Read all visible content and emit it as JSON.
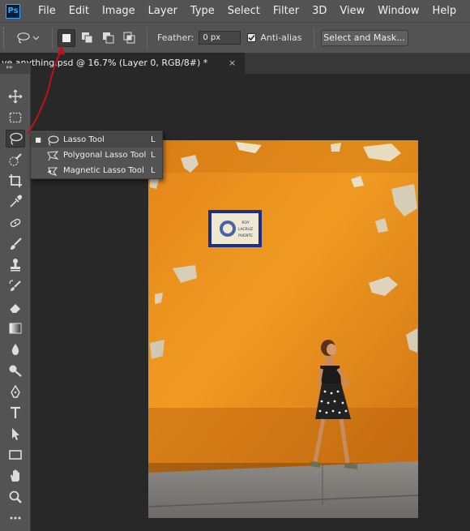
{
  "app": {
    "logo_text": "Ps"
  },
  "menu": [
    "File",
    "Edit",
    "Image",
    "Layer",
    "Type",
    "Select",
    "Filter",
    "3D",
    "View",
    "Window",
    "Help"
  ],
  "options": {
    "feather_label": "Feather:",
    "feather_value": "0 px",
    "antialias_label": "Anti-alias",
    "antialias_checked": true,
    "select_mask_label": "Select and Mask..."
  },
  "document": {
    "tab_title": "ve anything.psd @ 16.7% (Layer 0, RGB/8#) *",
    "close_glyph": "×"
  },
  "flyout": {
    "items": [
      {
        "label": "Lasso Tool",
        "shortcut": "L",
        "selected": true,
        "icon": "lasso-icon"
      },
      {
        "label": "Polygonal Lasso Tool",
        "shortcut": "L",
        "selected": false,
        "icon": "polygonal-lasso-icon"
      },
      {
        "label": "Magnetic Lasso Tool",
        "shortcut": "L",
        "selected": false,
        "icon": "magnetic-lasso-icon"
      }
    ]
  },
  "toolbar_icons": [
    "move-icon",
    "marquee-icon",
    "lasso-icon",
    "quick-selection-icon",
    "crop-icon",
    "eyedropper-icon",
    "healing-brush-icon",
    "brush-icon",
    "clone-stamp-icon",
    "history-brush-icon",
    "eraser-icon",
    "gradient-icon",
    "blur-icon",
    "dodge-icon",
    "pen-icon",
    "type-icon",
    "path-selection-icon",
    "rectangle-icon",
    "hand-icon",
    "zoom-icon",
    "more-tools-icon"
  ],
  "colors": {
    "chrome": "#535353",
    "canvas_bg": "#282828",
    "wall": "#e8901c",
    "annotation_arrow": "#c0101a"
  },
  "sign_text": "ROY 4 LACRUZ DEL PUENTE"
}
